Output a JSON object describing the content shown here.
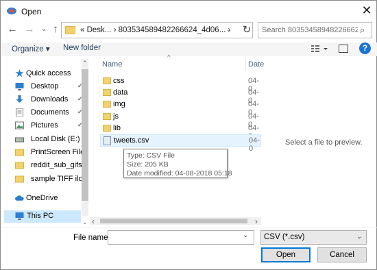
{
  "window": {
    "title": "Open",
    "close_glyph": "✕"
  },
  "nav": {
    "back_icon": "←",
    "forward_icon": "→",
    "recent_icon": "⌄",
    "up_icon": "↑",
    "address": "« Desk... › 803534589482266624_4d06... ›",
    "refresh_icon": "↻",
    "search_placeholder": "Search 803534589482266624_4...",
    "search_icon": "⌕"
  },
  "toolbar": {
    "organize_label": "Organize ▾",
    "new_folder_label": "New folder",
    "help_label": "?"
  },
  "sidebar": {
    "items": [
      {
        "label": "Quick access",
        "icon": "star-icon",
        "pinned": false
      },
      {
        "label": "Desktop",
        "icon": "desktop-icon",
        "pinned": true
      },
      {
        "label": "Downloads",
        "icon": "download-icon",
        "pinned": true
      },
      {
        "label": "Documents",
        "icon": "document-icon",
        "pinned": true
      },
      {
        "label": "Pictures",
        "icon": "picture-icon",
        "pinned": true
      },
      {
        "label": "Local Disk (E:)",
        "icon": "drive-icon",
        "pinned": false
      },
      {
        "label": "PrintScreen Files",
        "icon": "folder-icon",
        "pinned": false
      },
      {
        "label": "reddit_sub_gifs",
        "icon": "folder-icon",
        "pinned": false
      },
      {
        "label": "sample TIFF ilov",
        "icon": "folder-icon",
        "pinned": false
      },
      {
        "label": "OneDrive",
        "icon": "cloud-icon",
        "pinned": false
      },
      {
        "label": "This PC",
        "icon": "pc-icon",
        "pinned": false
      }
    ],
    "pin_glyph": "📌",
    "scroll_up": "⌃",
    "scroll_down": "⌄"
  },
  "file_list": {
    "headers": {
      "name": "Name",
      "date": "Date"
    },
    "sort_caret": "^",
    "files": [
      {
        "name": "css",
        "date": "04-0",
        "type": "folder"
      },
      {
        "name": "data",
        "date": "04-0",
        "type": "folder"
      },
      {
        "name": "img",
        "date": "04-0",
        "type": "folder"
      },
      {
        "name": "js",
        "date": "04-0",
        "type": "folder"
      },
      {
        "name": "lib",
        "date": "04-0",
        "type": "folder"
      },
      {
        "name": "tweets.csv",
        "date": "04-0",
        "type": "csv"
      }
    ],
    "tooltip": {
      "type_line": "Type: CSV File",
      "size_line": "Size: 205 KB",
      "modified_line": "Date modified: 04-08-2018 05:18"
    },
    "scroll_left": "‹",
    "scroll_right": "›"
  },
  "preview": {
    "text": "Select a file to preview."
  },
  "bottom": {
    "file_name_label": "File name:",
    "file_name_value": "",
    "file_type": "CSV (*.csv)",
    "open_label": "Open",
    "cancel_label": "Cancel",
    "dropdown_glyph": "⌄"
  },
  "colors": {
    "accent": "#0078d7",
    "selection": "#cce8ff",
    "folder": "#f3d26b",
    "help": "#1a74d2"
  }
}
